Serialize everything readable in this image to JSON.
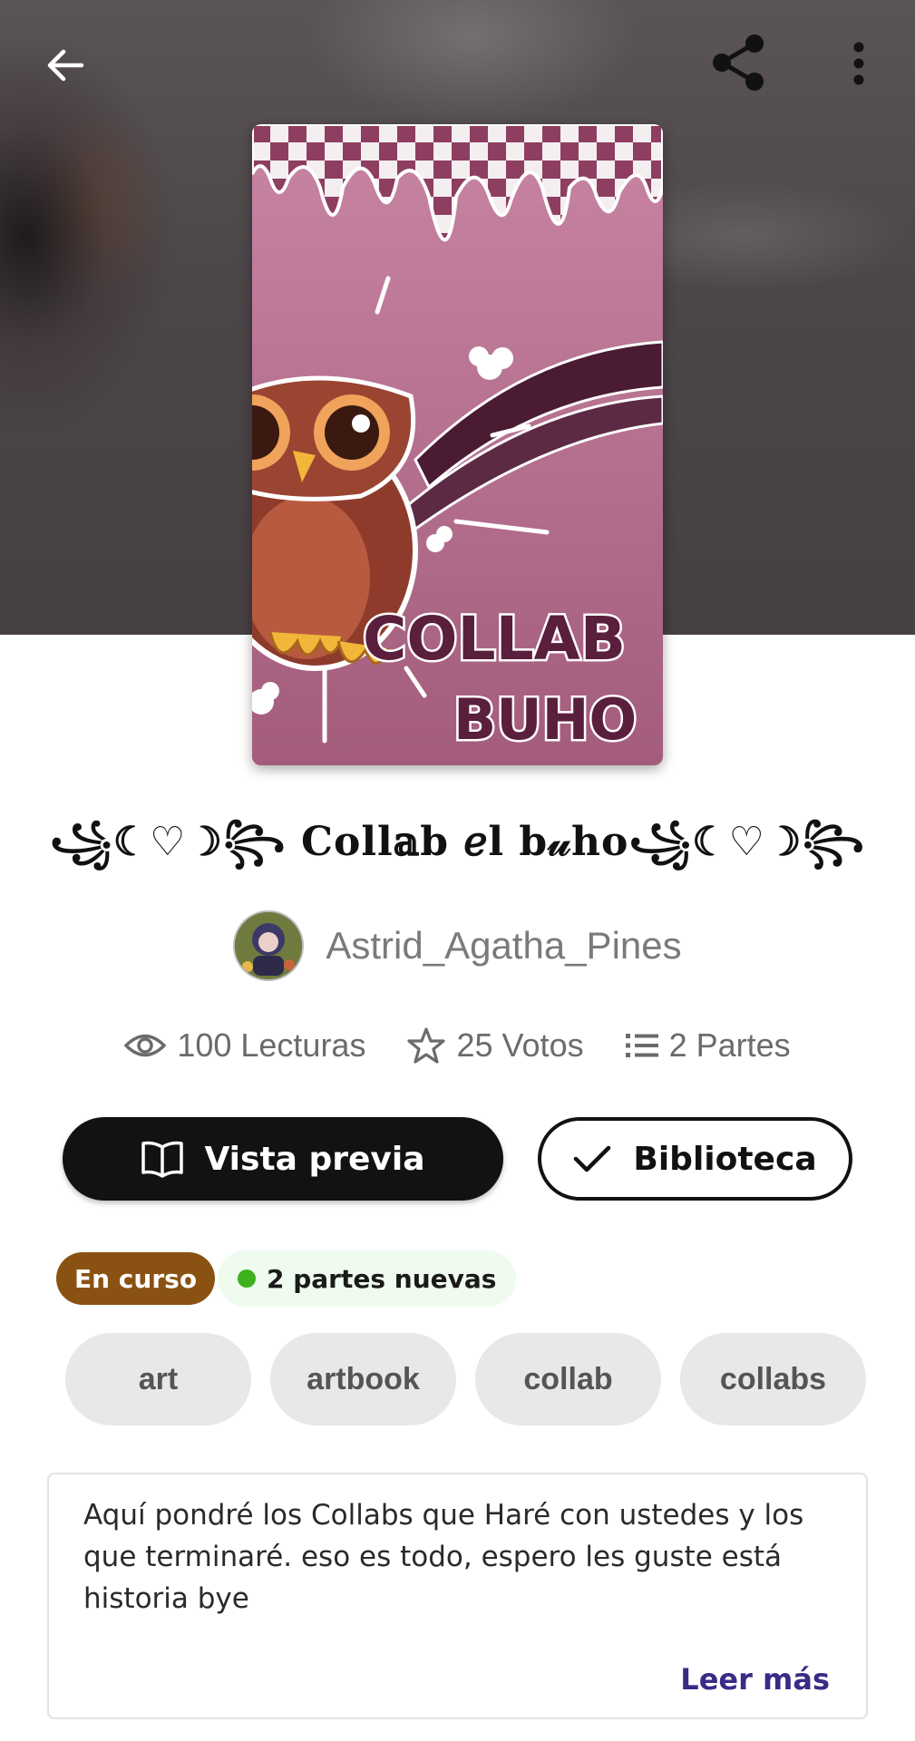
{
  "header": {
    "back_icon": "arrow-left-icon",
    "share_icon": "share-icon",
    "more_icon": "more-vertical-icon"
  },
  "cover": {
    "line1": "COLLAB",
    "line2": "BUHO"
  },
  "story": {
    "title": "꧁☾♡☽꧂ Coll𝕒b 𝑒l b𝓊ho꧁☾♡☽꧂",
    "author": "Astrid_Agatha_Pines"
  },
  "stats": {
    "reads": "100 Lecturas",
    "votes": "25 Votos",
    "parts": "2 Partes"
  },
  "actions": {
    "preview_label": "Vista previa",
    "library_label": "Biblioteca"
  },
  "badges": {
    "status": "En curso",
    "new_parts": "2 partes nuevas"
  },
  "tags": [
    "art",
    "artbook",
    "collab",
    "collabs"
  ],
  "description": {
    "text": "Aquí pondré los Collabs que Haré con ustedes y los que terminaré. eso es todo, espero les guste está historia bye",
    "read_more": "Leer más"
  },
  "colors": {
    "status_badge": "#8a5212",
    "new_dot": "#3fb01e",
    "read_more": "#3b2a86",
    "primary_button": "#121212"
  }
}
